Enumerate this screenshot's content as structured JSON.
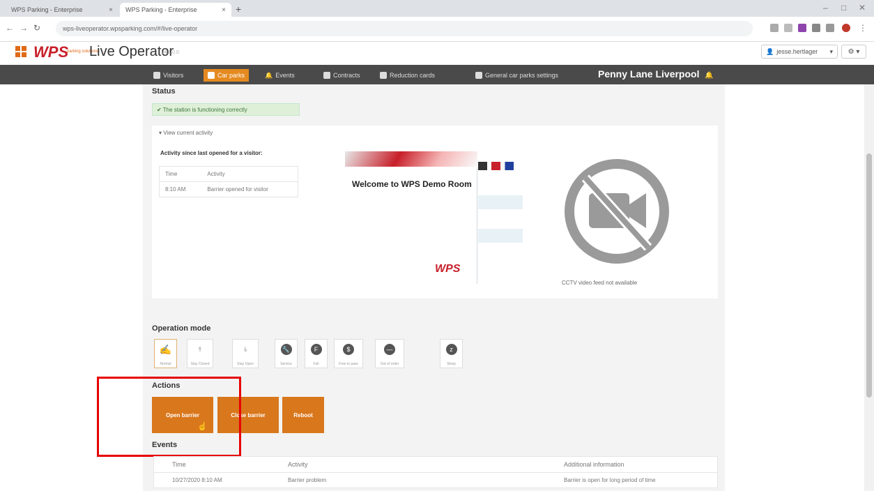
{
  "browser": {
    "tabs": [
      {
        "title": "WPS Parking - Enterprise"
      },
      {
        "title": "WPS Parking - Enterprise"
      }
    ],
    "new_tab": "+",
    "url": "wps-liveoperator.wpsparking.com/#/live-operator",
    "window_controls": [
      "–",
      "□",
      "✕"
    ]
  },
  "app": {
    "brand": "WPS",
    "brand_sub": "parking solutions",
    "title": "Live Operator",
    "version": "v4.1.0.0",
    "user": "jesse.hertlager",
    "settings_caret": "⚙ ▾"
  },
  "nav": {
    "items": [
      {
        "label": "Visitors"
      },
      {
        "label": "Car parks"
      },
      {
        "label": "Events"
      },
      {
        "label": "Contracts"
      },
      {
        "label": "Reduction cards"
      },
      {
        "label": "General car parks settings"
      }
    ],
    "location": "Penny Lane Liverpool"
  },
  "status": {
    "heading": "Status",
    "message": "✔ The station is functioning correctly"
  },
  "activity": {
    "toggle": "▾ View current activity",
    "heading": "Activity since last opened for a visitor:",
    "columns": [
      "Time",
      "Activity"
    ],
    "rows": [
      {
        "time": "8:10 AM",
        "activity": "Barrier opened for visitor"
      }
    ]
  },
  "display": {
    "welcome": "Welcome to WPS Demo Room",
    "logo": "WPS"
  },
  "cctv": {
    "message": "CCTV video feed not available"
  },
  "operation": {
    "heading": "Operation mode",
    "modes": [
      {
        "label": "Normal",
        "glyph": "✍",
        "active": true
      },
      {
        "label": "Stay Closed",
        "glyph": "⫯"
      },
      {
        "label": "Stay Open",
        "glyph": "⫰"
      },
      {
        "label": "Service",
        "glyph": "🔧"
      },
      {
        "label": "Full",
        "glyph": "F"
      },
      {
        "label": "Free to pass",
        "glyph": "$"
      },
      {
        "label": "Out of order",
        "glyph": "—"
      },
      {
        "label": "Sleep",
        "glyph": "z"
      }
    ]
  },
  "actions": {
    "heading": "Actions",
    "open_barrier": "Open barrier",
    "close_barrier": "Close barrier",
    "reboot": "Reboot"
  },
  "events": {
    "heading": "Events",
    "columns": [
      "Time",
      "Activity",
      "Additional information"
    ],
    "rows": [
      {
        "time": "10/27/2020 8:10 AM",
        "activity": "Barrier problem",
        "info": "Barrier is open for long period of time"
      }
    ]
  },
  "colors": {
    "accent": "#d9771c",
    "navbar": "#4a4a4a",
    "highlight": "#e80000"
  }
}
